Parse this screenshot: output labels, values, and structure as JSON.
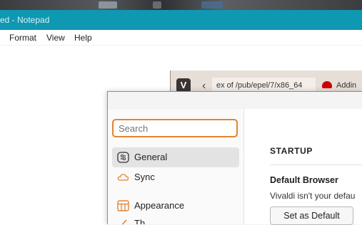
{
  "notepad": {
    "title": "ed - Notepad",
    "menu": [
      "Format",
      "View",
      "Help"
    ]
  },
  "browser": {
    "logo_glyph": "V",
    "back_glyph": "‹",
    "tab_title": "ex of /pub/epel/7/x86_64",
    "tab2_title": "Addin"
  },
  "settings": {
    "search": {
      "placeholder": "Search",
      "value": ""
    },
    "sidebar": [
      {
        "label": "General",
        "active": true,
        "icon": "general-icon"
      },
      {
        "label": "Sync",
        "active": false,
        "icon": "cloud-icon"
      },
      {
        "label": "Appearance",
        "active": false,
        "icon": "appearance-icon"
      },
      {
        "label": "Th",
        "active": false,
        "icon": "brush-icon"
      }
    ],
    "section_title": "STARTUP",
    "default_browser": {
      "title": "Default Browser",
      "description": "Vivaldi isn't your defau",
      "button_label": "Set as Default"
    }
  },
  "colors": {
    "notepad_titlebar": "#0e98b1",
    "search_focus": "#e3842f",
    "vivaldi_bar": "#e7dfd7",
    "accent_orange": "#e3842f"
  }
}
